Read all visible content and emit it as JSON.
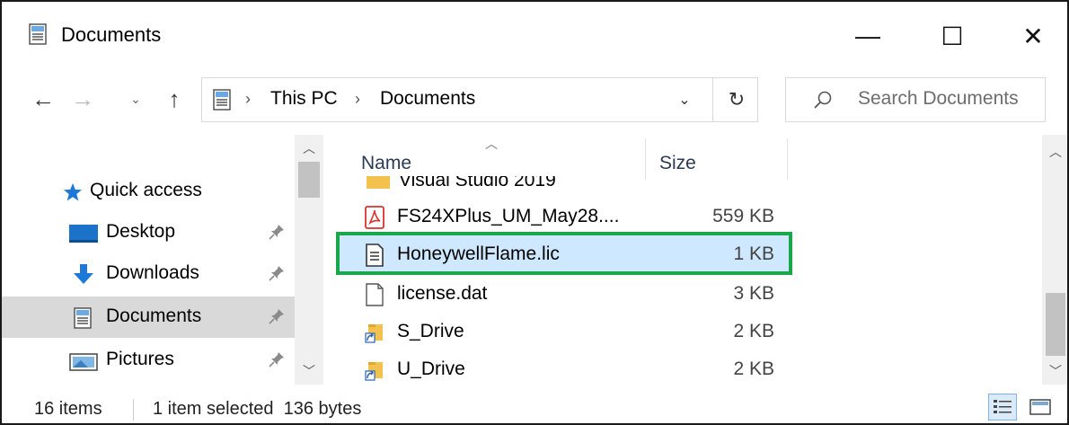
{
  "window": {
    "title": "Documents",
    "minimize_glyph": "—",
    "maximize_glyph": "☐",
    "close_glyph": "✕"
  },
  "nav": {
    "back_glyph": "←",
    "forward_glyph": "→",
    "recent_glyph": "⌄",
    "up_glyph": "↑"
  },
  "address": {
    "crumbs": [
      "This PC",
      "Documents"
    ],
    "separator": "›",
    "dropdown_glyph": "⌄",
    "refresh_glyph": "↻"
  },
  "search": {
    "placeholder": "Search Documents"
  },
  "sidebar": {
    "items": [
      {
        "label": "Quick access",
        "icon": "star-icon",
        "pinned": false
      },
      {
        "label": "Desktop",
        "icon": "desktop-icon",
        "pinned": true
      },
      {
        "label": "Downloads",
        "icon": "download-arrow-icon",
        "pinned": true
      },
      {
        "label": "Documents",
        "icon": "document-icon",
        "pinned": true,
        "selected": true
      },
      {
        "label": "Pictures",
        "icon": "pictures-icon",
        "pinned": true
      }
    ],
    "scroll_up_glyph": "︿",
    "scroll_down_glyph": "﹀"
  },
  "filelist": {
    "columns": {
      "name": "Name",
      "size": "Size"
    },
    "sort_glyph": "︿",
    "partial_row_name": "Visual Studio 2019",
    "rows": [
      {
        "name": "FS24XPlus_UM_May28....",
        "size": "559 KB",
        "icon": "pdf-icon"
      },
      {
        "name": "HoneywellFlame.lic",
        "size": "1 KB",
        "icon": "text-file-icon",
        "selected": true
      },
      {
        "name": "license.dat",
        "size": "3 KB",
        "icon": "blank-file-icon"
      },
      {
        "name": "S_Drive",
        "size": "2 KB",
        "icon": "folder-shortcut-icon"
      },
      {
        "name": "U_Drive",
        "size": "2 KB",
        "icon": "folder-shortcut-icon"
      }
    ],
    "scroll_up_glyph": "︿",
    "scroll_down_glyph": "﹀"
  },
  "status": {
    "item_count": "16 items",
    "selection": "1 item selected  136 bytes"
  },
  "colors": {
    "selection_bg": "#cde8ff",
    "highlight_border": "#1aa64a",
    "nav_selected_bg": "#d9d9d9"
  }
}
